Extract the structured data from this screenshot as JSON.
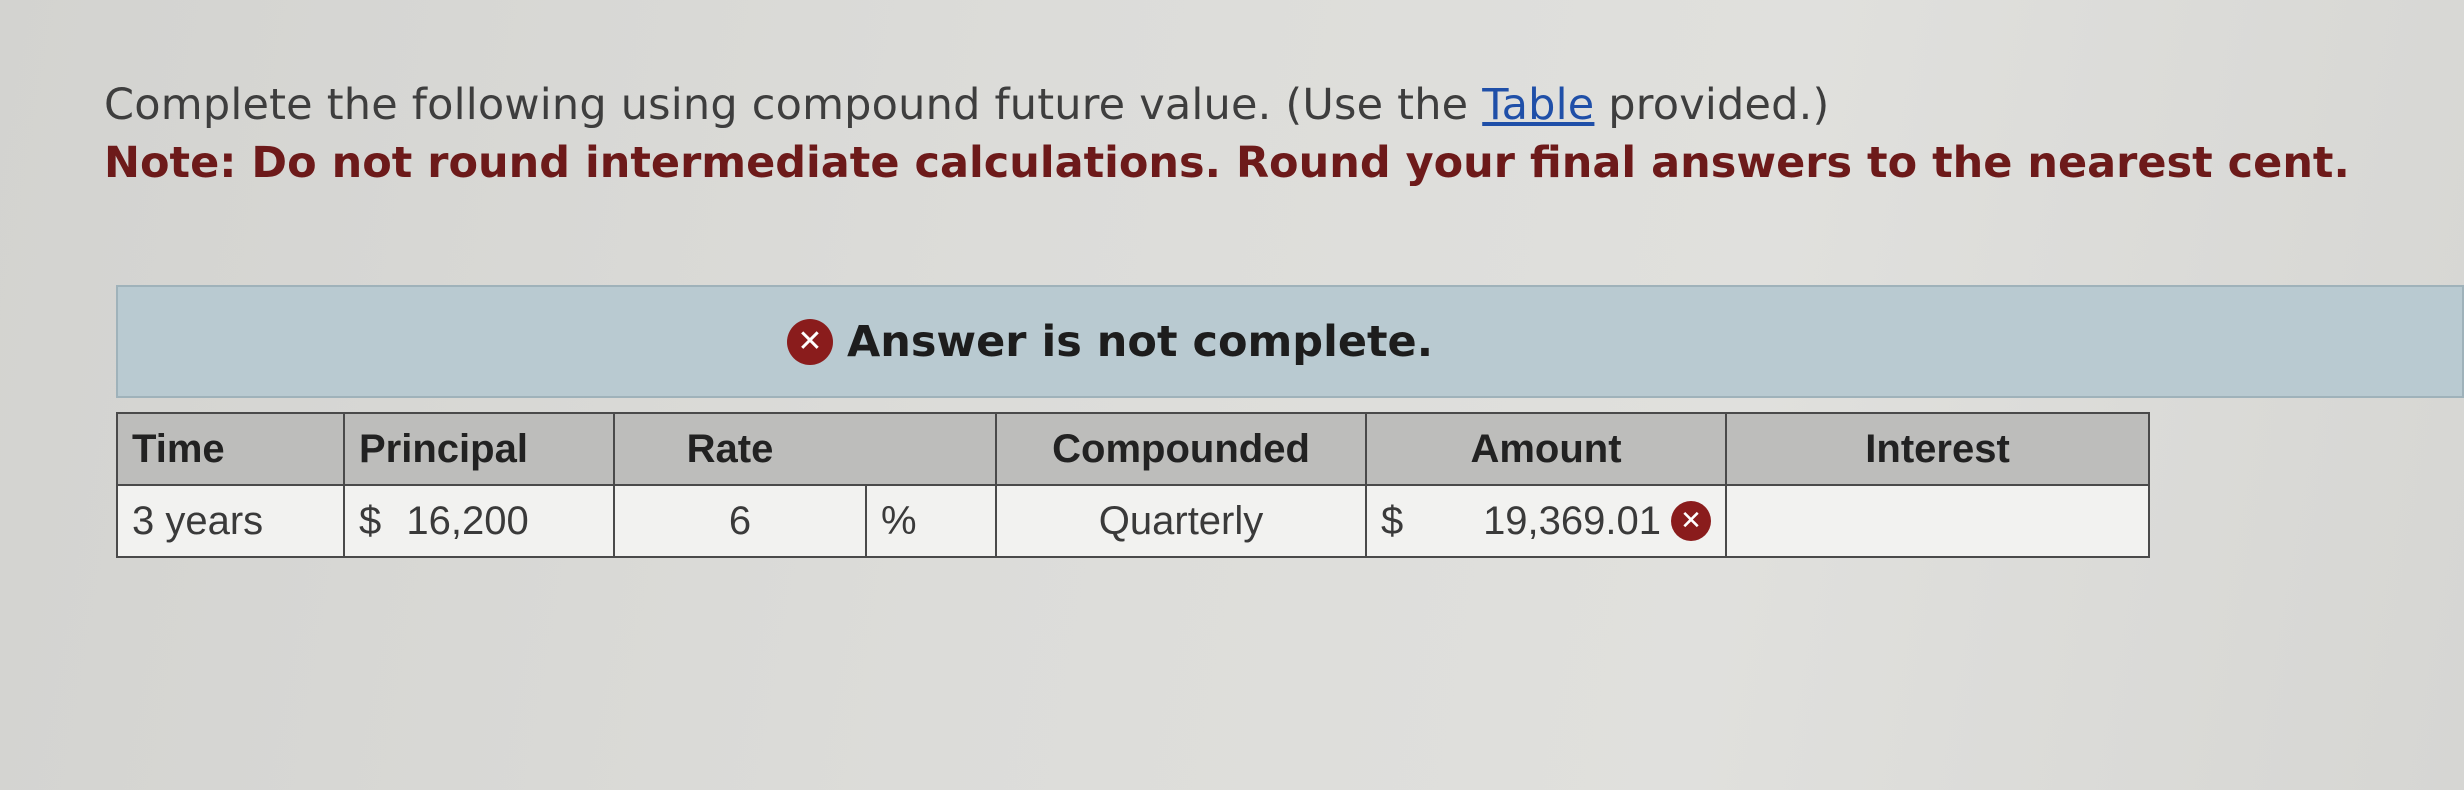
{
  "question": {
    "text_before_link": "Complete the following using compound future value. (Use the ",
    "link_text": "Table",
    "text_after_link": " provided.)",
    "note": "Note: Do not round intermediate calculations. Round your final answers to the nearest cent."
  },
  "banner": {
    "icon": "x-circle-icon",
    "icon_glyph": "✕",
    "message": "Answer is not complete."
  },
  "table": {
    "headers": {
      "time": "Time",
      "principal": "Principal",
      "rate": "Rate",
      "compounded": "Compounded",
      "amount": "Amount",
      "interest": "Interest"
    },
    "row": {
      "time": "3 years",
      "principal_currency": "$",
      "principal": "16,200",
      "rate": "6",
      "rate_unit": "%",
      "compounded": "Quarterly",
      "amount_currency": "$",
      "amount": "19,369.01",
      "amount_status_icon": "incorrect-x-icon",
      "interest": ""
    }
  },
  "colors": {
    "error": "#8a1c1c",
    "note": "#6d1a1a",
    "banner_bg": "#b9cad1",
    "header_bg": "#bdbdbb",
    "link": "#1f4fa8"
  }
}
